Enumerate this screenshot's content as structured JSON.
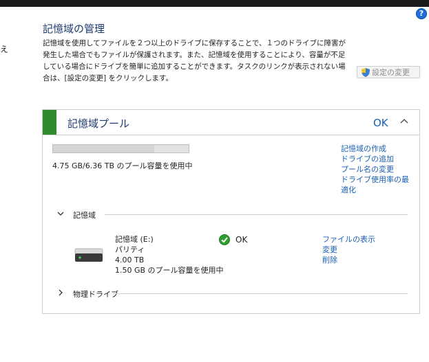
{
  "left_stub": "え",
  "help_glyph": "?",
  "page": {
    "title": "記憶域の管理",
    "description": "記憶域を使用してファイルを２つ以上のドライブに保存することで、１つのドライブに障害が発生した場合でもファイルが保護されます。また、記憶域を使用することにより、容量が不足している場合にドライブを簡単に追加することができます。タスクのリンクが表示されない場合は、[設定の変更] をクリックします。",
    "change_settings_label": "設定の変更"
  },
  "pool": {
    "title": "記憶域プール",
    "status": "OK",
    "usage_fraction": 0.747,
    "usage_text": "4.75 GB/6.36 TB のプール容量を使用中",
    "links": [
      "記憶域の作成",
      "ドライブの追加",
      "プール名の変更",
      "ドライブ使用率の最適化"
    ]
  },
  "storage_spaces": {
    "section_label": "記憶域",
    "expanded": true,
    "space": {
      "name": "記憶域 (E:)",
      "resiliency": "パリティ",
      "size": "4.00 TB",
      "usage": "1.50 GB のプール容量を使用中",
      "status": "OK",
      "links": [
        "ファイルの表示",
        "変更",
        "削除"
      ]
    }
  },
  "physical_drives": {
    "section_label": "物理ドライブ",
    "expanded": false
  },
  "colors": {
    "accent_green": "#2e8b2e",
    "link_blue": "#1a5fb4",
    "title_blue": "#1a3a6e"
  }
}
